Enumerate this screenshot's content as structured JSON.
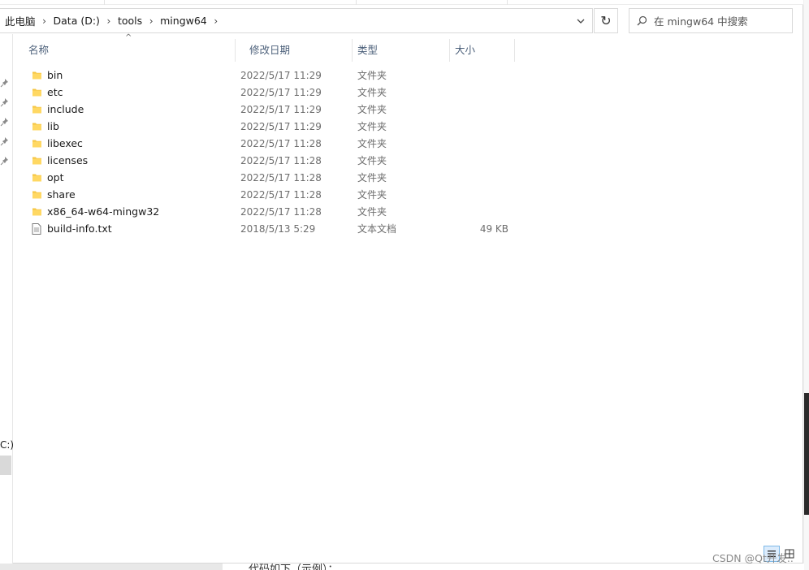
{
  "address": {
    "crumbs": [
      "此电脑",
      "Data (D:)",
      "tools",
      "mingw64"
    ]
  },
  "search": {
    "placeholder": "在 mingw64 中搜索"
  },
  "columns": {
    "name": "名称",
    "date": "修改日期",
    "type": "类型",
    "size": "大小"
  },
  "files": [
    {
      "name": "bin",
      "date": "2022/5/17 11:29",
      "type": "文件夹",
      "size": "",
      "icon": "folder-icon"
    },
    {
      "name": "etc",
      "date": "2022/5/17 11:29",
      "type": "文件夹",
      "size": "",
      "icon": "folder-icon"
    },
    {
      "name": "include",
      "date": "2022/5/17 11:29",
      "type": "文件夹",
      "size": "",
      "icon": "folder-icon"
    },
    {
      "name": "lib",
      "date": "2022/5/17 11:29",
      "type": "文件夹",
      "size": "",
      "icon": "folder-icon"
    },
    {
      "name": "libexec",
      "date": "2022/5/17 11:28",
      "type": "文件夹",
      "size": "",
      "icon": "folder-icon"
    },
    {
      "name": "licenses",
      "date": "2022/5/17 11:28",
      "type": "文件夹",
      "size": "",
      "icon": "folder-icon"
    },
    {
      "name": "opt",
      "date": "2022/5/17 11:28",
      "type": "文件夹",
      "size": "",
      "icon": "folder-icon"
    },
    {
      "name": "share",
      "date": "2022/5/17 11:28",
      "type": "文件夹",
      "size": "",
      "icon": "folder-icon"
    },
    {
      "name": "x86_64-w64-mingw32",
      "date": "2022/5/17 11:28",
      "type": "文件夹",
      "size": "",
      "icon": "folder-icon"
    },
    {
      "name": "build-info.txt",
      "date": "2018/5/13 5:29",
      "type": "文本文档",
      "size": "49 KB",
      "icon": "text-file-icon"
    }
  ],
  "nav": {
    "drive_label": "C:)"
  },
  "background": {
    "text": "代码如下（示例）："
  },
  "watermark": "CSDN @Qt开发..",
  "colors": {
    "folder": "#f5c542",
    "header_text": "#4c607a",
    "muted_text": "#6d6d6d"
  }
}
